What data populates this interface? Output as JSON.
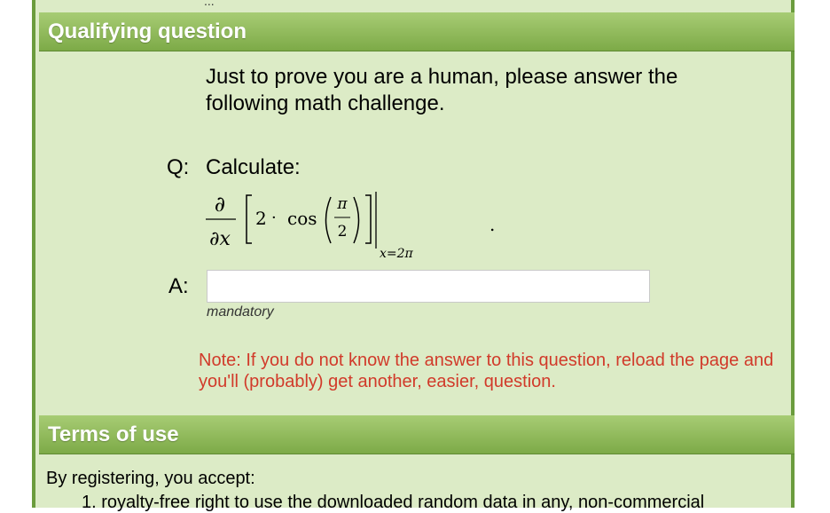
{
  "top_fragment": "...",
  "qualifying": {
    "title": "Qualifying question",
    "intro": "Just to prove you are a human, please answer the following math challenge.",
    "question_label": "Q:",
    "question_text": "Calculate:",
    "formula": {
      "numerator": "∂",
      "denominator": "∂x",
      "coefficient": "2",
      "dot": "·",
      "function": "cos",
      "frac_num": "π",
      "frac_den": "2",
      "evaluation": "x=2π",
      "period": "."
    },
    "answer_label": "A:",
    "answer_value": "",
    "answer_placeholder": "",
    "mandatory": "mandatory",
    "note": "Note: If you do not know the answer to this question, reload the page and you'll (probably) get another, easier, question."
  },
  "terms": {
    "title": "Terms of use",
    "intro": "By registering, you accept:",
    "items": [
      "1. royalty-free right to use the downloaded random data in any, non-commercial"
    ]
  },
  "colors": {
    "panel_bg": "#dcebc6",
    "border": "#6b9c3d",
    "header_bg": "#7daa47",
    "note_text": "#d13a2a"
  }
}
